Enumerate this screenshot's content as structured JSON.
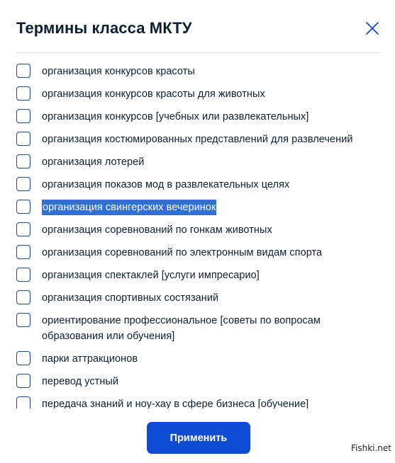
{
  "dialog": {
    "title": "Термины класса МКТУ",
    "apply_label": "Применить"
  },
  "terms": [
    {
      "label": "организация конкурсов красоты",
      "checked": false
    },
    {
      "label": "организация конкурсов красоты для животных",
      "checked": false
    },
    {
      "label": "организация конкурсов [учебных или развлекательных]",
      "checked": false
    },
    {
      "label": "организация костюмированных представлений для развлечений",
      "checked": false
    },
    {
      "label": "организация лотерей",
      "checked": false
    },
    {
      "label": "организация показов мод в развлекательных целях",
      "checked": false
    },
    {
      "label": "организация свингерских вечеринок",
      "checked": false,
      "highlighted": true
    },
    {
      "label": "организация соревнований по гонкам животных",
      "checked": false
    },
    {
      "label": "организация соревнований по электронным видам спорта",
      "checked": false
    },
    {
      "label": "организация спектаклей [услуги импресарио]",
      "checked": false
    },
    {
      "label": "организация спортивных состязаний",
      "checked": false
    },
    {
      "label": "ориентирование профессиональное [советы по вопросам образования или обучения]",
      "checked": false
    },
    {
      "label": "парки аттракционов",
      "checked": false
    },
    {
      "label": "перевод устный",
      "checked": false
    },
    {
      "label": "передача знаний и ноу-хау в сфере бизнеса [обучение]",
      "checked": false
    }
  ],
  "watermark": "Fishki.net",
  "colors": {
    "primary": "#0d4cd3",
    "checkbox_border": "#1c4a8f",
    "selection": "#2f6fd6",
    "text": "#0b1f33"
  }
}
